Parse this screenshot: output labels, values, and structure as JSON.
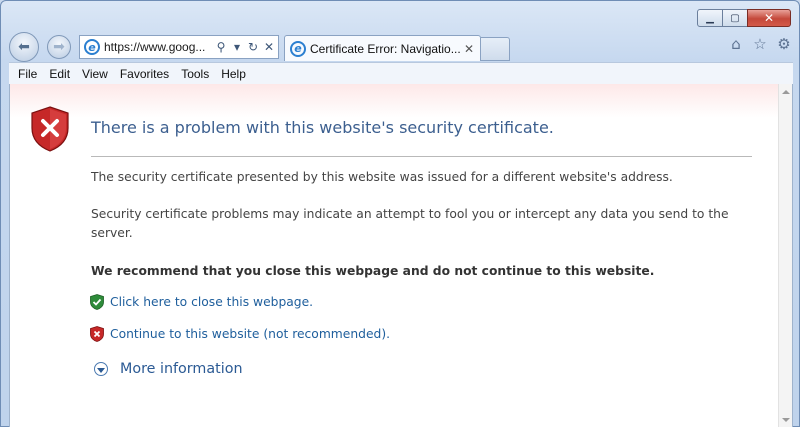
{
  "browser": {
    "address_text": "https://www.goog...",
    "tab_title": "Certificate Error: Navigatio...",
    "menu": [
      "File",
      "Edit",
      "View",
      "Favorites",
      "Tools",
      "Help"
    ],
    "icons": {
      "back": "back-arrow-icon",
      "forward": "forward-arrow-icon",
      "site": "ie-logo-icon",
      "search": "search-icon",
      "dropdown": "chevron-down-icon",
      "refresh": "refresh-icon",
      "stop": "close-icon",
      "home": "home-icon",
      "favorites": "star-icon",
      "tools": "gear-icon"
    }
  },
  "page": {
    "title": "There is a problem with this website's security certificate.",
    "para1": "The security certificate presented by this website was issued for a different website's address.",
    "para2": "Security certificate problems may indicate an attempt to fool you or intercept any data you send to the server.",
    "recommend": "We recommend that you close this webpage and do not continue to this website.",
    "close_link": "Click here to close this webpage.",
    "continue_link": "Continue to this website (not recommended).",
    "more_info": "More information"
  },
  "colors": {
    "title": "#3c5f8f",
    "link": "#1e5e9c",
    "shield_red": "#c62828",
    "shield_green": "#2e8b3a"
  }
}
